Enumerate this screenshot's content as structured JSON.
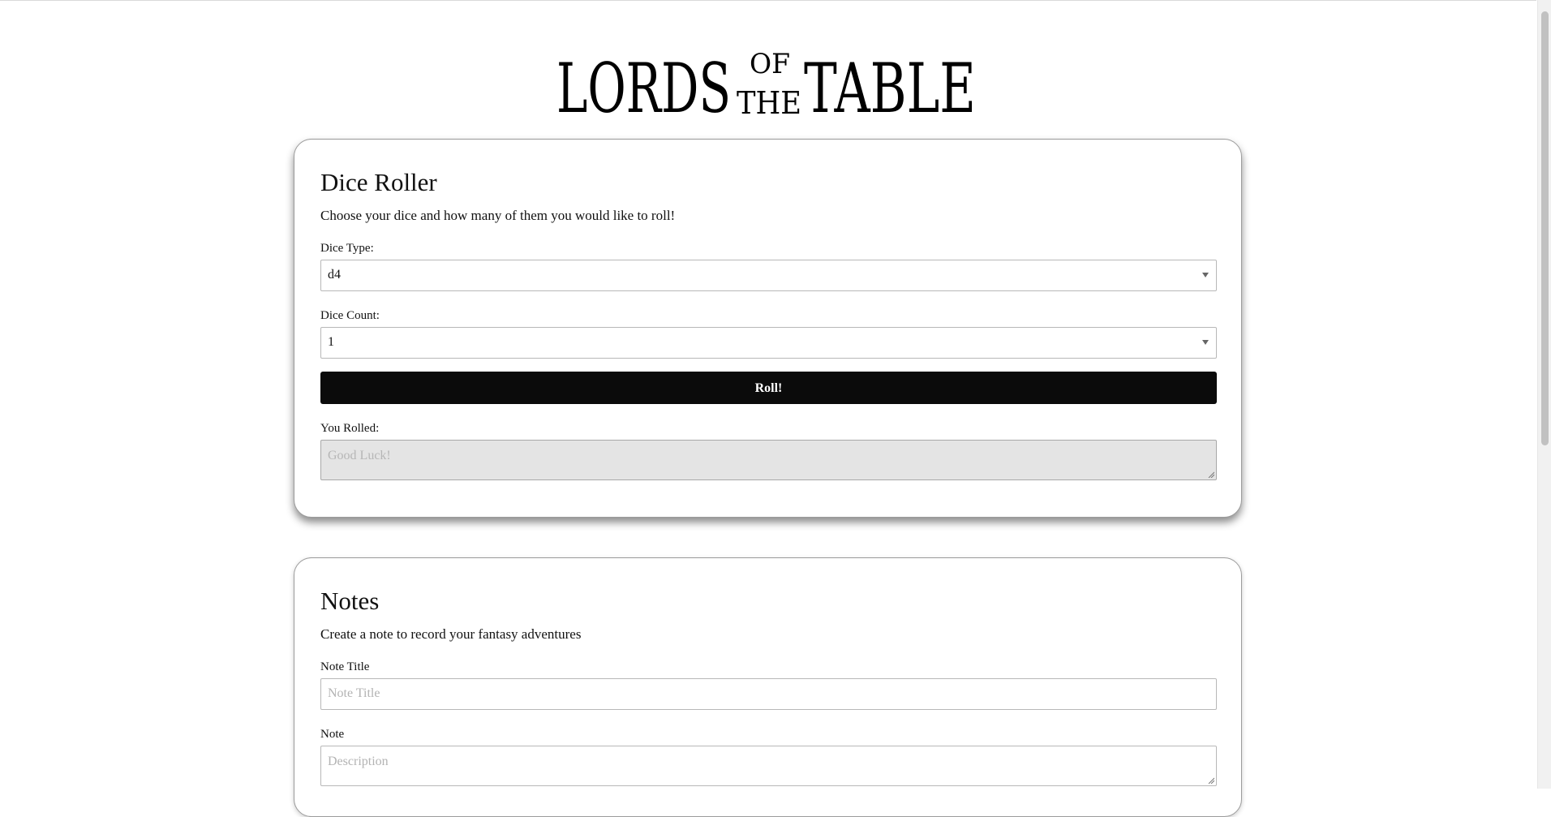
{
  "logo": {
    "word_lords": "LORDS",
    "word_of": "OF",
    "word_the": "THE",
    "word_table": "TABLE"
  },
  "dice_roller": {
    "title": "Dice Roller",
    "description": "Choose your dice and how many of them you would like to roll!",
    "dice_type_label": "Dice Type:",
    "dice_type_value": "d4",
    "dice_count_label": "Dice Count:",
    "dice_count_value": "1",
    "roll_button": "Roll!",
    "result_label": "You Rolled:",
    "result_placeholder": "Good Luck!"
  },
  "notes": {
    "title": "Notes",
    "description": "Create a note to record your fantasy adventures",
    "note_title_label": "Note Title",
    "note_title_placeholder": "Note Title",
    "note_label": "Note",
    "note_placeholder": "Description"
  }
}
